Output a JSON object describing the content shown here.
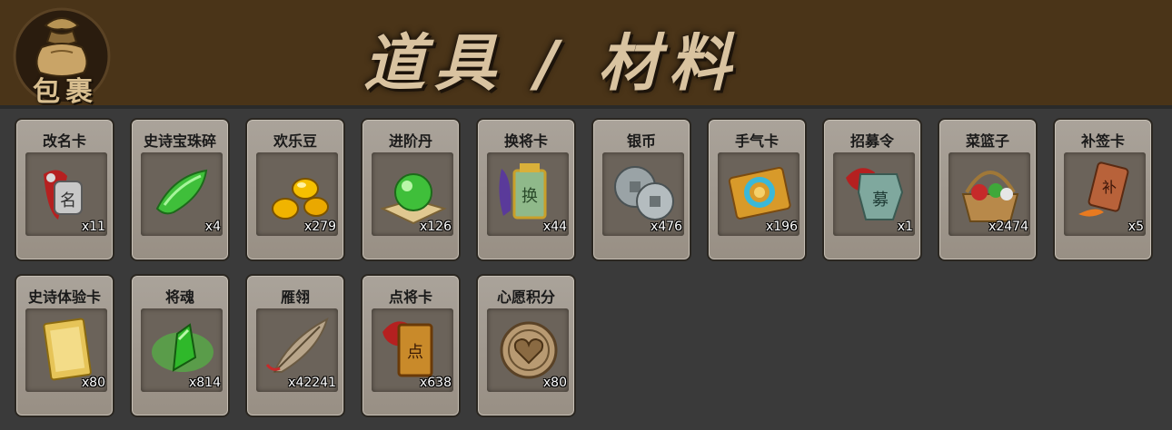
{
  "header": {
    "bag_label": "包裹",
    "title": "道具 / 材料"
  },
  "items": [
    {
      "name": "改名卡",
      "count": "x11",
      "icon": "rename-card-icon"
    },
    {
      "name": "史诗宝珠碎",
      "count": "x4",
      "icon": "epic-orb-shard-icon"
    },
    {
      "name": "欢乐豆",
      "count": "x279",
      "icon": "happy-beans-icon"
    },
    {
      "name": "进阶丹",
      "count": "x126",
      "icon": "advance-pill-icon"
    },
    {
      "name": "换将卡",
      "count": "x44",
      "icon": "swap-general-card-icon"
    },
    {
      "name": "银币",
      "count": "x476",
      "icon": "silver-coin-icon"
    },
    {
      "name": "手气卡",
      "count": "x196",
      "icon": "luck-card-icon"
    },
    {
      "name": "招募令",
      "count": "x1",
      "icon": "recruit-token-icon"
    },
    {
      "name": "菜篮子",
      "count": "x2474",
      "icon": "vegetable-basket-icon"
    },
    {
      "name": "补签卡",
      "count": "x5",
      "icon": "makeup-signin-card-icon"
    },
    {
      "name": "史诗体验卡",
      "count": "x80",
      "icon": "epic-trial-card-icon"
    },
    {
      "name": "将魂",
      "count": "x814",
      "icon": "general-soul-icon"
    },
    {
      "name": "雁翎",
      "count": "x42241",
      "icon": "goose-feather-icon"
    },
    {
      "name": "点将卡",
      "count": "x638",
      "icon": "pick-general-card-icon"
    },
    {
      "name": "心愿积分",
      "count": "x80",
      "icon": "wish-points-coin-icon"
    }
  ]
}
